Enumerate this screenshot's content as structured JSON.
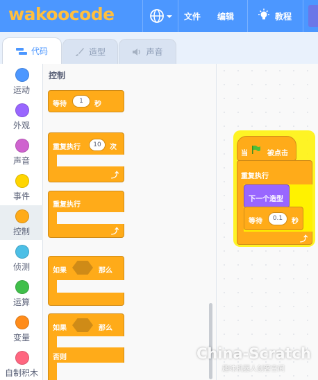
{
  "menubar": {
    "logo": "wakoocode",
    "menu_file": "文件",
    "menu_edit": "编辑",
    "menu_tutorial": "教程",
    "color": "#4c97ff",
    "logo_color": "#ffbf3f"
  },
  "tabs": [
    {
      "label": "代码",
      "icon": "code-blocks-icon",
      "active": true
    },
    {
      "label": "造型",
      "icon": "brush-icon",
      "active": false
    },
    {
      "label": "声音",
      "icon": "speaker-icon",
      "active": false
    }
  ],
  "categories": [
    {
      "label": "运动",
      "color": "#4c97ff"
    },
    {
      "label": "外观",
      "color": "#9966ff"
    },
    {
      "label": "声音",
      "color": "#cf63cf"
    },
    {
      "label": "事件",
      "color": "#ffd500"
    },
    {
      "label": "控制",
      "color": "#ffab19",
      "selected": true
    },
    {
      "label": "侦测",
      "color": "#4cbfe6"
    },
    {
      "label": "运算",
      "color": "#40bf4a"
    },
    {
      "label": "变量",
      "color": "#ff8c1a"
    },
    {
      "label": "自制积木",
      "color": "#ff6680"
    }
  ],
  "palette": {
    "title": "控制",
    "wait_block": {
      "prefix": "等待",
      "value": "1",
      "suffix": "秒"
    },
    "repeat_block": {
      "label": "重复执行",
      "value": "10",
      "suffix": "次"
    },
    "forever_block": {
      "label": "重复执行"
    },
    "if_block": {
      "label": "如果",
      "then": "那么"
    },
    "if_else_block": {
      "label": "如果",
      "then": "那么",
      "else": "否则"
    }
  },
  "script": {
    "hat": {
      "prefix": "当",
      "suffix": "被点击"
    },
    "forever_label": "重复执行",
    "next_costume": "下一个造型",
    "wait": {
      "prefix": "等待",
      "value": "0.1",
      "suffix": "秒"
    }
  },
  "watermark": {
    "main": "China-Scratch",
    "sub": "趣味机器人创客空间"
  },
  "colors": {
    "control": "#ffab19",
    "looks": "#9966ff",
    "selection_glow": "#fff200"
  }
}
